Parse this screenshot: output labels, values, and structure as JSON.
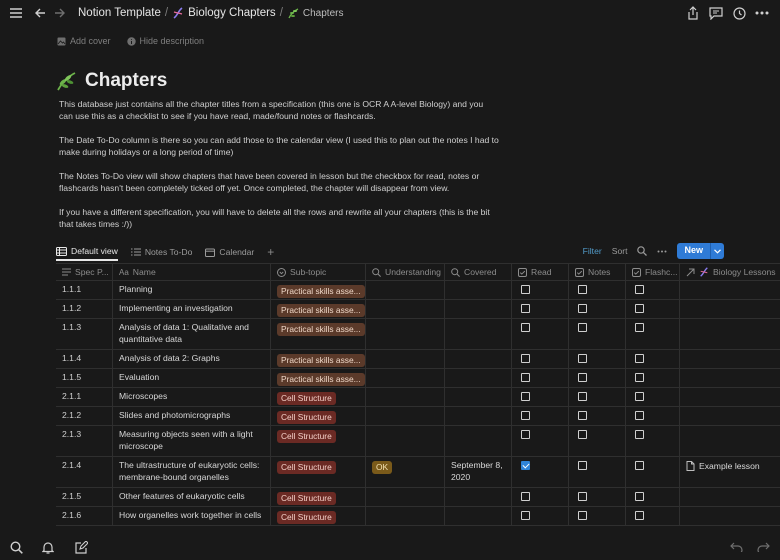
{
  "breadcrumb": {
    "root": "Notion Template",
    "parent": "Biology Chapters",
    "current": "Chapters"
  },
  "page_actions": {
    "add_cover": "Add cover",
    "hide_description": "Hide description"
  },
  "page": {
    "title": "Chapters",
    "description": [
      "This database just contains all the chapter titles from a specification (this one is OCR A A-level Biology) and you can use this as a checklist to see if you have read, made/found notes or flashcards.",
      "The Date To-Do column is there so you can add those to the calendar view (I used this to plan out the notes I had to make during holidays or a long period of time)",
      "The Notes To-Do view will show chapters that have been covered in lesson but the checkbox for read, notes or flashcards hasn't been completely ticked off yet. Once completed, the chapter will disappear from view.",
      "If you have a different specification, you will have to delete all the rows and rewrite all your chapters (this is the bit that takes times :/))"
    ]
  },
  "views": {
    "tabs": [
      "Default view",
      "Notes To-Do",
      "Calendar"
    ],
    "add": "+",
    "filter": "Filter",
    "sort": "Sort",
    "new": "New"
  },
  "table": {
    "columns": [
      "Spec P...",
      "Name",
      "Sub-topic",
      "Understanding",
      "Covered",
      "Read",
      "Notes",
      "Flashc...",
      "Biology Lessons"
    ],
    "rows": [
      {
        "spec": "1.1.1",
        "name": "Planning",
        "subtopic": "Practical skills asse...",
        "understanding": "",
        "covered": "",
        "read": false,
        "notes": false,
        "flash": false,
        "lesson": ""
      },
      {
        "spec": "1.1.2",
        "name": "Implementing an investigation",
        "subtopic": "Practical skills asse...",
        "understanding": "",
        "covered": "",
        "read": false,
        "notes": false,
        "flash": false,
        "lesson": ""
      },
      {
        "spec": "1.1.3",
        "name": "Analysis of data 1: Qualitative and quantitative data",
        "subtopic": "Practical skills asse...",
        "understanding": "",
        "covered": "",
        "read": false,
        "notes": false,
        "flash": false,
        "lesson": ""
      },
      {
        "spec": "1.1.4",
        "name": "Analysis of data 2: Graphs",
        "subtopic": "Practical skills asse...",
        "understanding": "",
        "covered": "",
        "read": false,
        "notes": false,
        "flash": false,
        "lesson": ""
      },
      {
        "spec": "1.1.5",
        "name": "Evaluation",
        "subtopic": "Practical skills asse...",
        "understanding": "",
        "covered": "",
        "read": false,
        "notes": false,
        "flash": false,
        "lesson": ""
      },
      {
        "spec": "2.1.1",
        "name": "Microscopes",
        "subtopic": "Cell Structure",
        "understanding": "",
        "covered": "",
        "read": false,
        "notes": false,
        "flash": false,
        "lesson": ""
      },
      {
        "spec": "2.1.2",
        "name": "Slides and photomicrographs",
        "subtopic": "Cell Structure",
        "understanding": "",
        "covered": "",
        "read": false,
        "notes": false,
        "flash": false,
        "lesson": ""
      },
      {
        "spec": "2.1.3",
        "name": "Measuring objects seen with a light microscope",
        "subtopic": "Cell Structure",
        "understanding": "",
        "covered": "",
        "read": false,
        "notes": false,
        "flash": false,
        "lesson": ""
      },
      {
        "spec": "2.1.4",
        "name": "The ultrastructure of eukaryotic cells: membrane-bound organelles",
        "subtopic": "Cell Structure",
        "understanding": "OK",
        "covered": "September 8, 2020",
        "read": true,
        "notes": false,
        "flash": false,
        "lesson": "Example lesson"
      },
      {
        "spec": "2.1.5",
        "name": "Other features of eukaryotic cells",
        "subtopic": "Cell Structure",
        "understanding": "",
        "covered": "",
        "read": false,
        "notes": false,
        "flash": false,
        "lesson": ""
      },
      {
        "spec": "2.1.6",
        "name": "How organelles work together in cells",
        "subtopic": "Cell Structure",
        "understanding": "",
        "covered": "",
        "read": false,
        "notes": false,
        "flash": false,
        "lesson": ""
      }
    ]
  },
  "colors": {
    "background": "#191919",
    "practical_tag": "#5b3a2a",
    "cell_tag": "#6b2a24",
    "ok_tag": "#7a5a1a",
    "accent": "#2f7bd6"
  }
}
